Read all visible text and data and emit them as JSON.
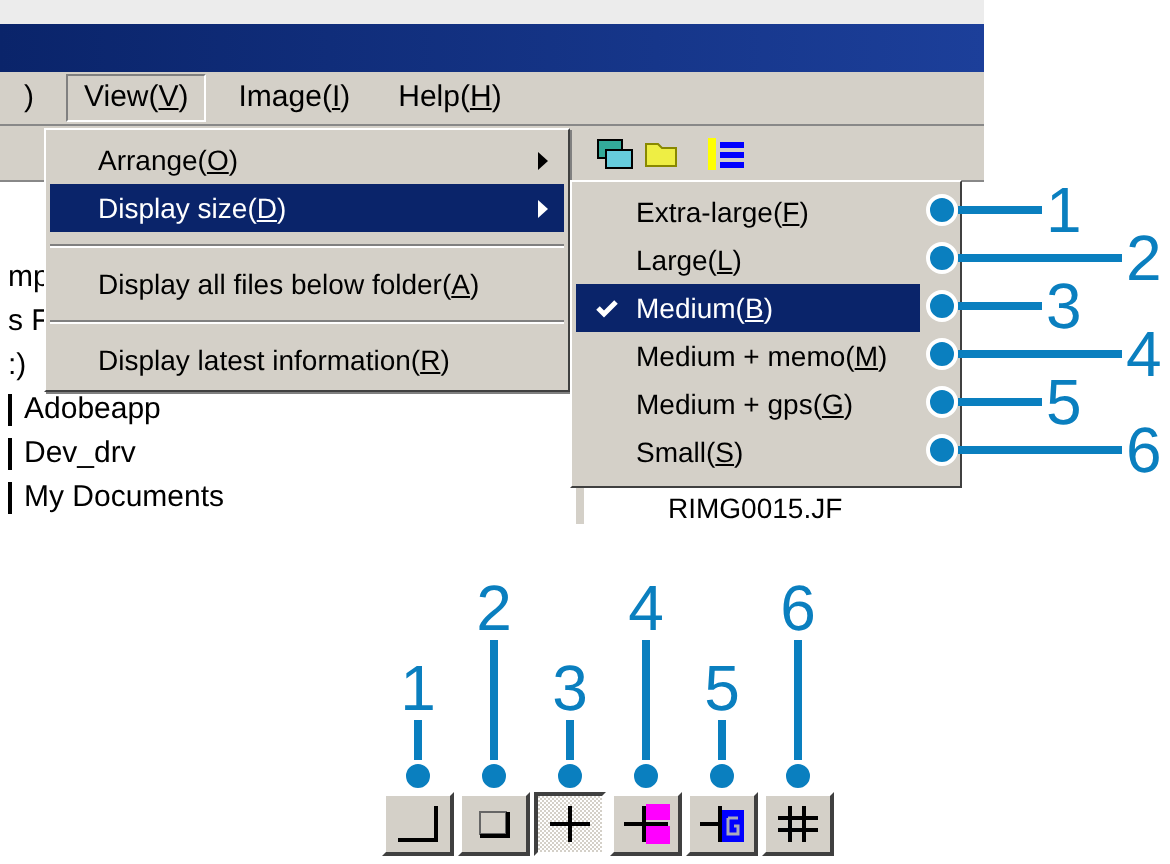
{
  "menu_bar": [
    {
      "pre": ")",
      "selected": false
    },
    {
      "pre": "View(",
      "key": "V",
      "post": ")",
      "selected": true
    },
    {
      "pre": "Image(",
      "key": "I",
      "post": ")",
      "selected": false
    },
    {
      "pre": "Help(",
      "key": "H",
      "post": ")",
      "selected": false
    }
  ],
  "tree": [
    {
      "text": "mp",
      "line": false
    },
    {
      "text": "s F",
      "line": false
    },
    {
      "text": ":)",
      "line": false
    },
    {
      "text": "Adobeapp",
      "line": true
    },
    {
      "text": "Dev_drv",
      "line": true
    },
    {
      "text": "My Documents",
      "line": true
    }
  ],
  "file_list": {
    "name": "RIMG0015.JF"
  },
  "view_menu": [
    {
      "kind": "submenu",
      "pre": "Arrange(",
      "key": "O",
      "post": ")",
      "selected": false
    },
    {
      "kind": "submenu",
      "pre": "Display size(",
      "key": "D",
      "post": ")",
      "selected": true
    },
    {
      "kind": "separator"
    },
    {
      "kind": "item",
      "pre": "Display all files below folder(",
      "key": "A",
      "post": ")",
      "selected": false
    },
    {
      "kind": "separator"
    },
    {
      "kind": "item",
      "pre": "Display latest information(",
      "key": "R",
      "post": ")",
      "selected": false
    }
  ],
  "display_size_menu": [
    {
      "pre": "Extra-large(",
      "key": "F",
      "post": ")",
      "checked": false,
      "selected": false,
      "callout": "1"
    },
    {
      "pre": "Large(",
      "key": "L",
      "post": ")",
      "checked": false,
      "selected": false,
      "callout": "2"
    },
    {
      "pre": "Medium(",
      "key": "B",
      "post": ")",
      "checked": true,
      "selected": true,
      "callout": "3"
    },
    {
      "pre": "Medium + memo(",
      "key": "M",
      "post": ")",
      "checked": false,
      "selected": false,
      "callout": "4"
    },
    {
      "pre": "Medium + gps(",
      "key": "G",
      "post": ")",
      "checked": false,
      "selected": false,
      "callout": "5"
    },
    {
      "pre": "Small(",
      "key": "S",
      "post": ")",
      "checked": false,
      "selected": false,
      "callout": "6"
    }
  ],
  "size_toolbar": [
    {
      "kind": "extra-large",
      "selected": false,
      "callout": "1"
    },
    {
      "kind": "large",
      "selected": false,
      "callout": "2"
    },
    {
      "kind": "medium",
      "selected": true,
      "callout": "3"
    },
    {
      "kind": "memo",
      "selected": false,
      "callout": "4"
    },
    {
      "kind": "gps",
      "selected": false,
      "callout": "5"
    },
    {
      "kind": "small",
      "selected": false,
      "callout": "6"
    }
  ]
}
